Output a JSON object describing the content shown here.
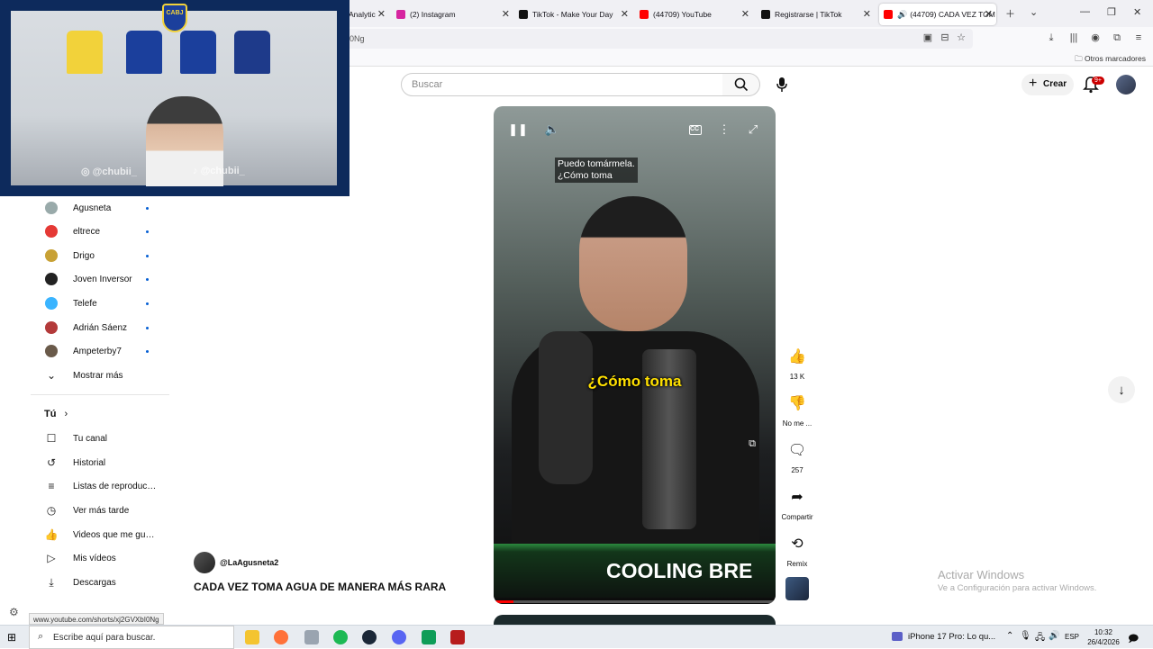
{
  "browser": {
    "tabs": [
      {
        "label": "Analytic",
        "color": "#e8710a"
      },
      {
        "label": "(2) Instagram",
        "color": "#d6249f"
      },
      {
        "label": "TikTok - Make Your Day",
        "color": "#111111"
      },
      {
        "label": "(44709) YouTube",
        "color": "#ff0000"
      },
      {
        "label": "Registrarse | TikTok",
        "color": "#111111"
      },
      {
        "label": "(44709) CADA VEZ TOM",
        "color": "#ff0000"
      }
    ],
    "url_fragment": "0Ng",
    "other_bookmarks": "Otros marcadores",
    "status_url": "www.youtube.com/shorts/xj2GVXbI0Ng"
  },
  "webcam": {
    "handle_instagram": "@chubii_",
    "handle_tiktok": "@chubii_",
    "crest": "CABJ"
  },
  "youtube": {
    "search_placeholder": "Buscar",
    "create_label": "Crear",
    "notif_badge": "9+",
    "subscriptions": [
      {
        "name": "Agusneta",
        "color": "#9aa"
      },
      {
        "name": "eltrece",
        "color": "#e53935"
      },
      {
        "name": "Drigo",
        "color": "#c8a135"
      },
      {
        "name": "Joven Inversor",
        "color": "#222222"
      },
      {
        "name": "Telefe",
        "color": "#3ab4ff"
      },
      {
        "name": "Adrián Sáenz",
        "color": "#b33a3a"
      },
      {
        "name": "Ampeterby7",
        "color": "#6a5a4a"
      }
    ],
    "show_more": "Mostrar más",
    "you_section": "Tú",
    "you_items": [
      {
        "label": "Tu canal",
        "icon": "person-icon"
      },
      {
        "label": "Historial",
        "icon": "history-icon"
      },
      {
        "label": "Listas de reproducción",
        "icon": "playlist-icon"
      },
      {
        "label": "Ver más tarde",
        "icon": "clock-icon"
      },
      {
        "label": "Videos que me gustan",
        "icon": "like-icon"
      },
      {
        "label": "Mis vídeos",
        "icon": "play-icon"
      },
      {
        "label": "Descargas",
        "icon": "download-icon"
      }
    ],
    "video": {
      "subtitle_small_1": "Puedo tomármela.",
      "subtitle_small_2": "¿Cómo toma",
      "subtitle_big": "¿Cómo toma",
      "banner_text": "COOLING BRE",
      "progress": 0.07
    },
    "actions": {
      "likes": "13 K",
      "dislike": "No me ...",
      "comments": "257",
      "share": "Compartir",
      "remix": "Remix"
    },
    "channel_handle": "@LaAgusneta2",
    "title": "CADA VEZ TOMA AGUA DE MANERA MÁS RARA"
  },
  "windows": {
    "activate_title": "Activar Windows",
    "activate_sub": "Ve a Configuración para activar Windows.",
    "search_placeholder": "Escribe aquí para buscar.",
    "media": "iPhone 17 Pro: Lo qu...",
    "lang": "ESP",
    "time": "10:32",
    "date": "26/4/2026"
  }
}
